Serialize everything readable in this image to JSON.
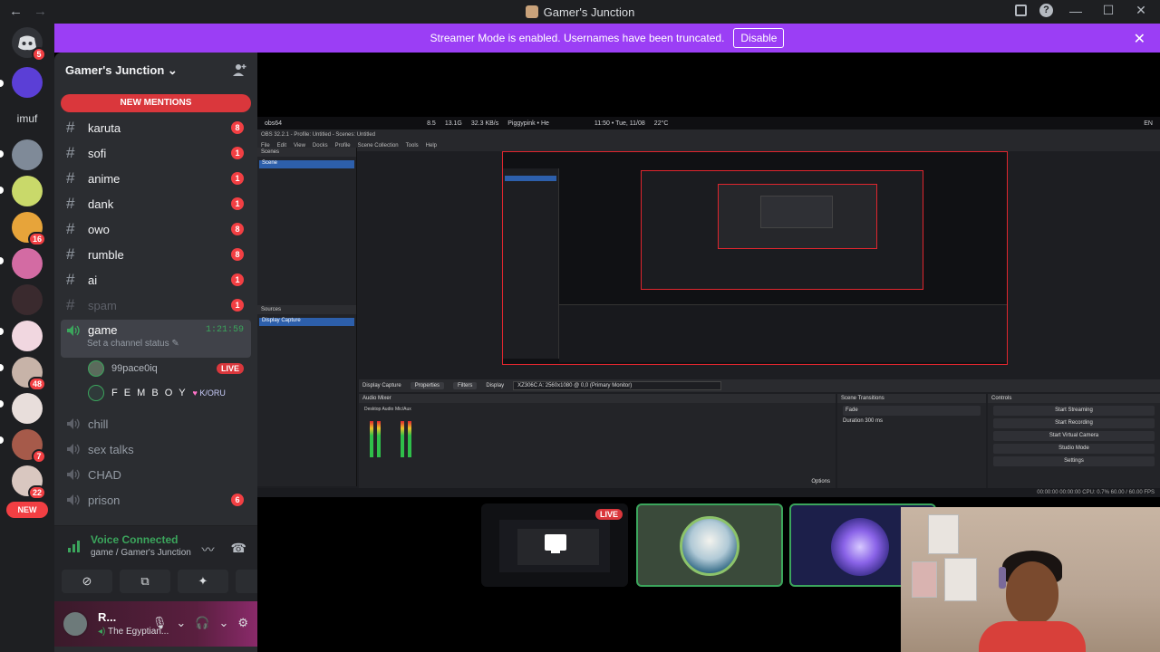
{
  "window": {
    "title": "Gamer's Junction",
    "help": "?"
  },
  "banner": {
    "message": "Streamer Mode is enabled. Usernames have been truncated.",
    "disable_label": "Disable"
  },
  "guilds": {
    "home_badge": "5",
    "text_guild": "imuf",
    "badges": [
      "16",
      "48",
      "7",
      "22"
    ],
    "new_label": "NEW"
  },
  "server": {
    "name": "Gamer's Junction",
    "new_mentions": "NEW MENTIONS"
  },
  "channels": [
    {
      "name": "karuta",
      "badge": "8"
    },
    {
      "name": "sofi",
      "badge": "1"
    },
    {
      "name": "anime",
      "badge": "1"
    },
    {
      "name": "dank",
      "badge": "1"
    },
    {
      "name": "owo",
      "badge": "8"
    },
    {
      "name": "rumble",
      "badge": "8"
    },
    {
      "name": "ai",
      "badge": "1"
    },
    {
      "name": "spam",
      "badge": "1"
    }
  ],
  "voice": {
    "active_channel": "game",
    "timer": "1:21:59",
    "status_prompt": "Set a channel status",
    "users": [
      {
        "name": "99pace0iq",
        "tag": "LIVE"
      },
      {
        "name": "F E M B O Y",
        "tag": "K/ORU"
      }
    ],
    "other_channels": [
      {
        "name": "chill",
        "badge": ""
      },
      {
        "name": "sex talks",
        "badge": ""
      },
      {
        "name": "CHAD",
        "badge": ""
      },
      {
        "name": "prison",
        "badge": "6"
      }
    ]
  },
  "voice_panel": {
    "title": "Voice Connected",
    "subtitle": "game / Gamer's Junction"
  },
  "user_panel": {
    "name": "R...",
    "status": "The Egyptian..."
  },
  "obs": {
    "title": "OBS 32.2.1 - Profile: Untitled - Scenes: Untitled",
    "topbar": {
      "app": "obs64",
      "cpu": "8.5",
      "ram": "13.1G",
      "net": "32.3 KB/s",
      "media": "Piggypink • He",
      "clock": "11:50 • Tue, 11/08",
      "temp": "22°C",
      "lang": "EN"
    },
    "menu": [
      "File",
      "Edit",
      "View",
      "Docks",
      "Profile",
      "Scene Collection",
      "Tools",
      "Help"
    ],
    "scenes_header": "Scenes",
    "scene_selected": "Scene",
    "sources_header": "Sources",
    "source_selected": "Display Capture",
    "source_bar": {
      "name": "Display Capture",
      "properties": "Properties",
      "filters": "Filters",
      "display_label": "Display",
      "display_value": "XZ306C A: 2560x1080 @ 0,0 (Primary Monitor)"
    },
    "audio_mixer": "Audio Mixer",
    "mixer_channels": [
      "Desktop Audio",
      "Mic/Aux"
    ],
    "transitions": {
      "header": "Scene Transitions",
      "value": "Fade",
      "duration_label": "Duration",
      "duration_value": "300 ms"
    },
    "controls": {
      "header": "Controls",
      "buttons": [
        "Start Streaming",
        "Start Recording",
        "Start Virtual Camera",
        "Studio Mode",
        "Settings"
      ]
    },
    "options": "Options",
    "status": "00:00:00   00:00:00   CPU: 0.7%   60.00 / 60.00 FPS"
  },
  "stage": {
    "live_label": "LIVE"
  }
}
